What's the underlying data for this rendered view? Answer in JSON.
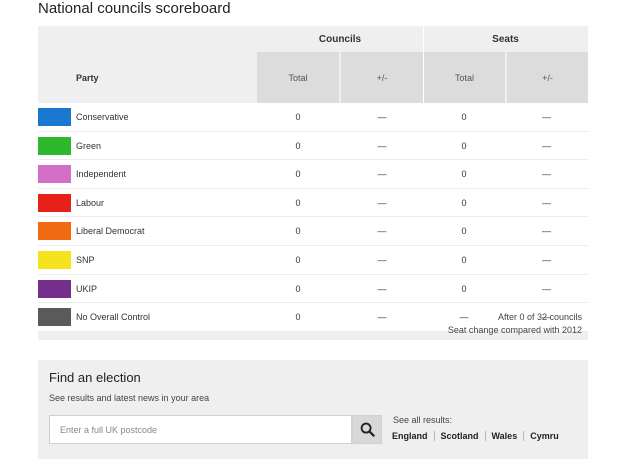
{
  "title": "National councils scoreboard",
  "header": {
    "party": "Party",
    "councils": "Councils",
    "seats": "Seats",
    "total": "Total",
    "change": "+/-"
  },
  "rows": [
    {
      "party": "Conservative",
      "color": "#1a78d0",
      "councils_total": "0",
      "councils_change": "—",
      "seats_total": "0",
      "seats_change": "—"
    },
    {
      "party": "Green",
      "color": "#2eb82e",
      "councils_total": "0",
      "councils_change": "—",
      "seats_total": "0",
      "seats_change": "—"
    },
    {
      "party": "Independent",
      "color": "#d36fc6",
      "councils_total": "0",
      "councils_change": "—",
      "seats_total": "0",
      "seats_change": "—"
    },
    {
      "party": "Labour",
      "color": "#e8201a",
      "councils_total": "0",
      "councils_change": "—",
      "seats_total": "0",
      "seats_change": "—"
    },
    {
      "party": "Liberal Democrat",
      "color": "#ef6a11",
      "councils_total": "0",
      "councils_change": "—",
      "seats_total": "0",
      "seats_change": "—"
    },
    {
      "party": "SNP",
      "color": "#f5e41d",
      "councils_total": "0",
      "councils_change": "—",
      "seats_total": "0",
      "seats_change": "—"
    },
    {
      "party": "UKIP",
      "color": "#742f8d",
      "councils_total": "0",
      "councils_change": "—",
      "seats_total": "0",
      "seats_change": "—"
    },
    {
      "party": "No Overall Control",
      "color": "#5a5a5a",
      "councils_total": "0",
      "councils_change": "—",
      "seats_total": "—",
      "seats_change": "—"
    }
  ],
  "footnote": {
    "line1": "After 0 of 32 councils",
    "line2": "Seat change compared with 2012"
  },
  "finder": {
    "title": "Find an election",
    "subtitle": "See results and latest news in your area",
    "postcode_placeholder": "Enter a full UK postcode",
    "see_all": "See all results:",
    "links": [
      "England",
      "Scotland",
      "Wales",
      "Cymru"
    ]
  }
}
